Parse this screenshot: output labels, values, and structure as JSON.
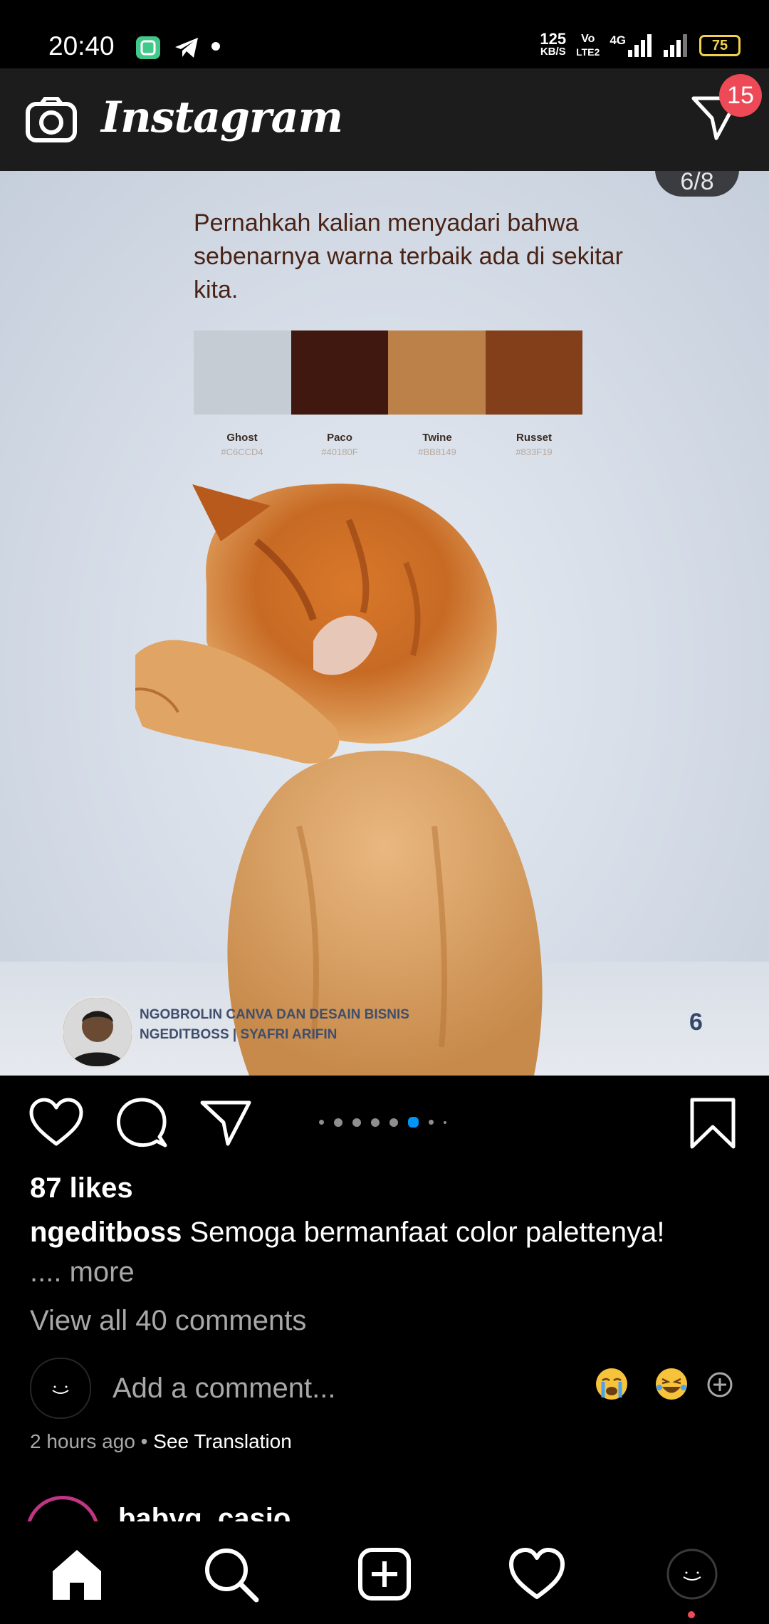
{
  "status_bar": {
    "time": "20:40",
    "net_speed_value": "125",
    "net_speed_unit": "KB/S",
    "volte_top": "Vo",
    "volte_bottom": "LTE2",
    "network": "4G",
    "battery": "75"
  },
  "header": {
    "brand": "Instagram",
    "dm_badge": "15"
  },
  "post": {
    "counter": "6/8",
    "headline": "Pernahkah kalian menyadari bahwa sebenarnya warna terbaik ada di sekitar kita.",
    "palette": [
      {
        "name": "Ghost",
        "hex": "#C6CCD4",
        "color": "#c6ccd4"
      },
      {
        "name": "Paco",
        "hex": "#40180F",
        "color": "#40180f"
      },
      {
        "name": "Twine",
        "hex": "#BB8149",
        "color": "#bb8149"
      },
      {
        "name": "Russet",
        "hex": "#833F19",
        "color": "#833f19"
      }
    ],
    "credit_line1": "NGOBROLIN CANVA DAN DESAIN BISNIS",
    "credit_line2": "NGEDITBOSS | SYAFRI ARIFIN",
    "page_number": "6",
    "carousel": {
      "total": 8,
      "current_index": 5
    }
  },
  "engagement": {
    "likes": "87 likes",
    "username": "ngeditboss",
    "caption": "Semoga bermanfaat color palettenya!",
    "more": ".... more",
    "view_comments": "View all 40 comments",
    "comment_placeholder": "Add a comment...",
    "time_ago": "2 hours ago",
    "separator": " • ",
    "see_translation": "See Translation"
  },
  "next_post": {
    "username": "babyq_casio"
  },
  "colors": {
    "accent_blue": "#0095f6",
    "badge_red": "#ed4956",
    "header_bg": "#1c1c1c"
  }
}
